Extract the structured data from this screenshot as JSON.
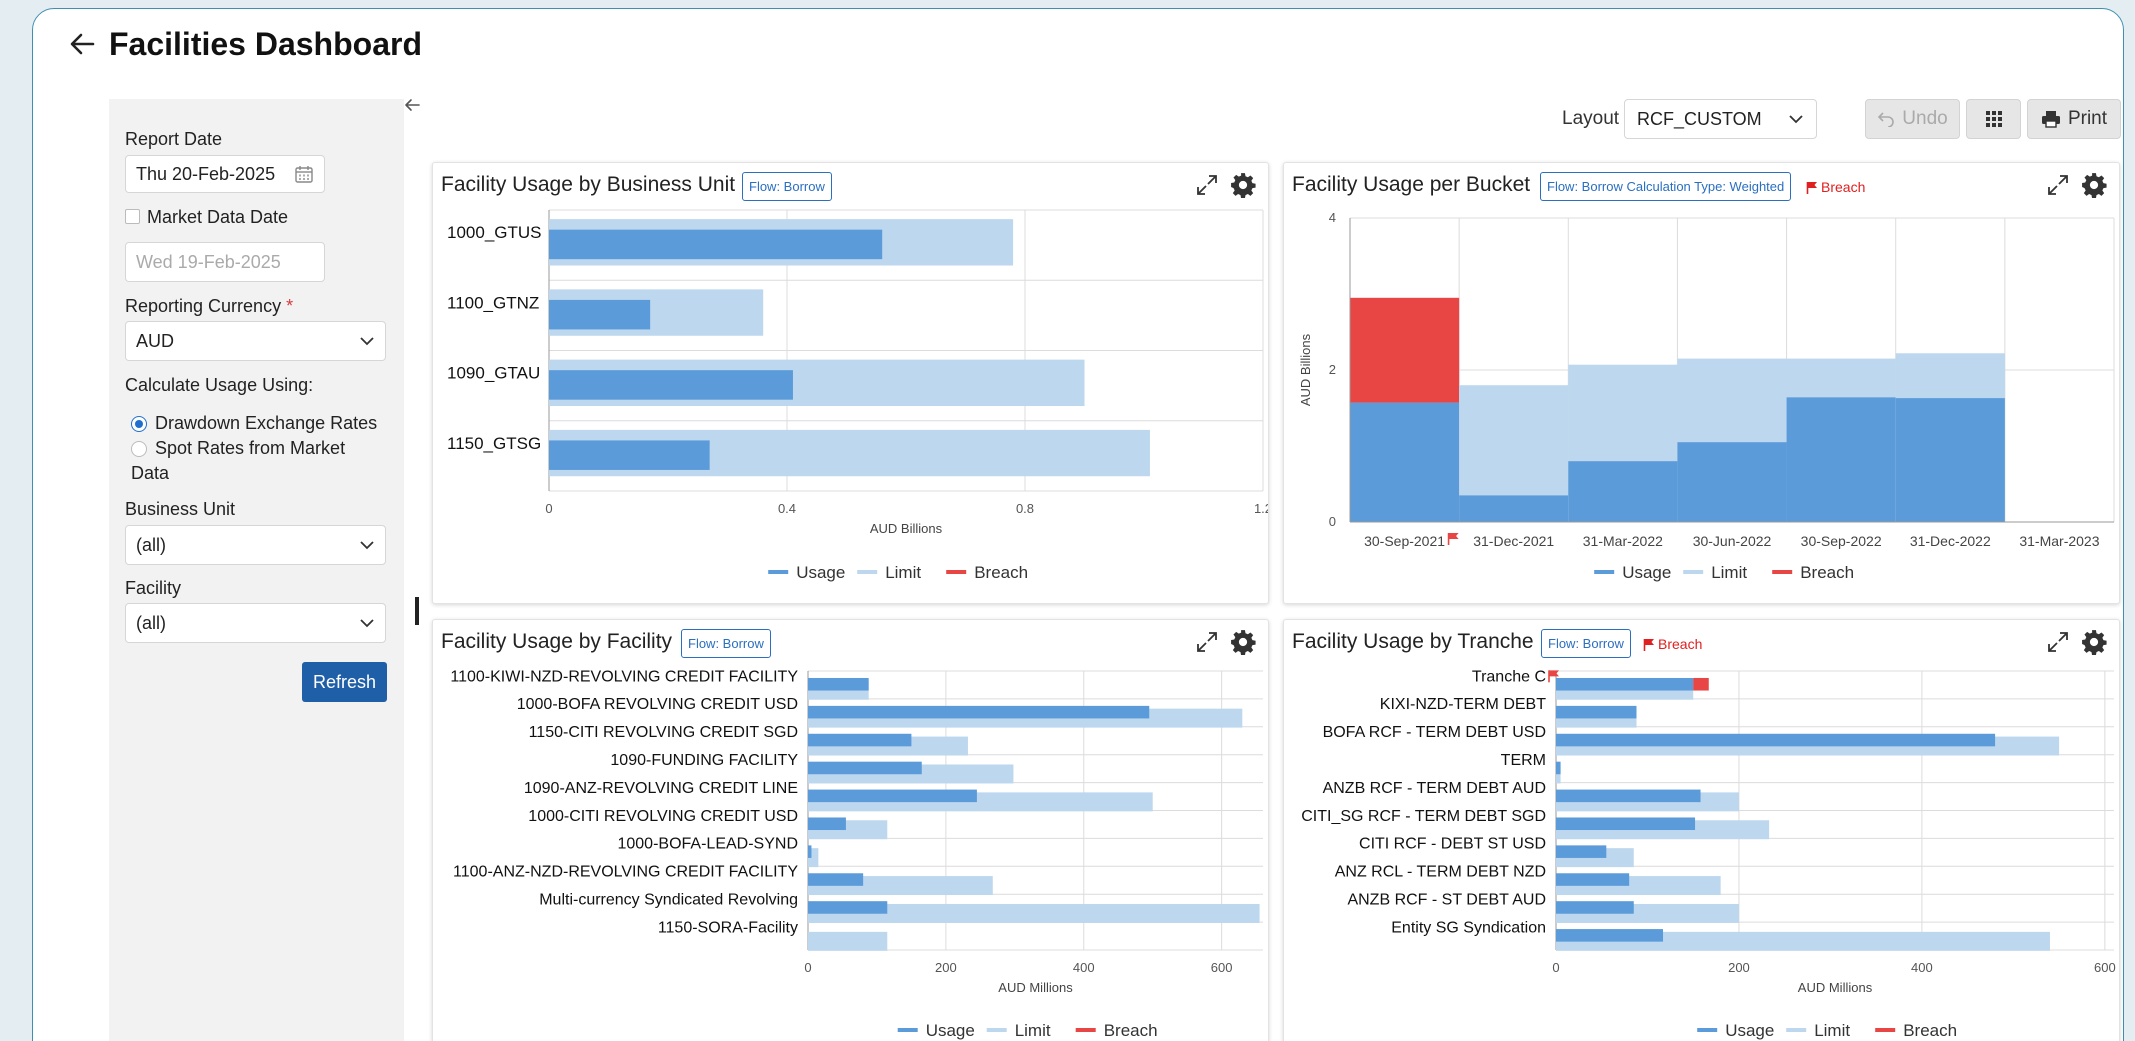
{
  "page": {
    "title": "Facilities Dashboard"
  },
  "sidebar": {
    "report_date_label": "Report Date",
    "report_date_value": "Thu 20-Feb-2025",
    "market_data_date_label": "Market Data Date",
    "market_data_date_placeholder": "Wed 19-Feb-2025",
    "reporting_currency_label": "Reporting Currency",
    "required_mark": "*",
    "reporting_currency_value": "AUD",
    "calc_usage_label": "Calculate Usage Using:",
    "radio_drawdown_label": "Drawdown Exchange Rates",
    "radio_spot_label_line1": "Spot Rates from Market",
    "radio_spot_label_line2": "Data",
    "business_unit_label": "Business Unit",
    "business_unit_value": "(all)",
    "facility_label": "Facility",
    "facility_value": "(all)",
    "refresh_label": "Refresh"
  },
  "toolbar": {
    "layout_label": "Layout",
    "layout_value": "RCF_CUSTOM",
    "undo_label": "Undo",
    "print_label": "Print"
  },
  "legend": {
    "usage": "Usage",
    "limit": "Limit",
    "breach": "Breach"
  },
  "colors": {
    "usage": "#5b9bd9",
    "limit": "#bdd7ee",
    "breach": "#e84545",
    "accent": "#1f5fa8"
  },
  "panels": {
    "bu": {
      "title": "Facility Usage by Business Unit",
      "tag": "Flow: Borrow"
    },
    "bucket": {
      "title": "Facility Usage per Bucket",
      "tag": "Flow: Borrow Calculation Type: Weighted",
      "breach_label": "Breach"
    },
    "facility": {
      "title": "Facility Usage by Facility",
      "tag": "Flow: Borrow"
    },
    "tranche": {
      "title": "Facility Usage by Tranche",
      "tag": "Flow: Borrow",
      "breach_label": "Breach"
    }
  },
  "chart_data": [
    {
      "id": "bu",
      "type": "bar",
      "orientation": "horizontal",
      "categories": [
        "1000_GTUS",
        "1100_GTNZ",
        "1090_GTAU",
        "1150_GTSG"
      ],
      "series": [
        {
          "name": "Usage",
          "values": [
            0.56,
            0.17,
            0.41,
            0.27
          ]
        },
        {
          "name": "Limit",
          "values": [
            0.78,
            0.36,
            0.9,
            1.01
          ]
        }
      ],
      "xlabel": "AUD Billions",
      "xlim": [
        0,
        1.2
      ],
      "ticks": [
        "0",
        "0.4",
        "0.8",
        "1.2"
      ],
      "grid": true,
      "legend": "bottom"
    },
    {
      "id": "bucket",
      "type": "area",
      "x": [
        "30-Sep-2021",
        "31-Dec-2021",
        "31-Mar-2022",
        "30-Jun-2022",
        "30-Sep-2022",
        "31-Dec-2022",
        "31-Mar-2023"
      ],
      "series": [
        {
          "name": "Usage",
          "values": [
            1.57,
            0.35,
            0.8,
            1.05,
            1.64,
            1.63,
            0
          ]
        },
        {
          "name": "Limit",
          "values": [
            1.57,
            1.8,
            2.07,
            2.15,
            2.15,
            2.22,
            0
          ]
        },
        {
          "name": "Breach",
          "values": [
            2.95,
            0,
            0,
            0,
            0,
            0,
            0
          ]
        }
      ],
      "ylabel": "AUD Billions",
      "ylim": [
        0,
        4
      ],
      "yticks": [
        "0",
        "2",
        "4"
      ],
      "breach_flag_category": "30-Sep-2021",
      "grid": true,
      "legend": "bottom"
    },
    {
      "id": "facility",
      "type": "bar",
      "orientation": "horizontal",
      "categories": [
        "1100-KIWI-NZD-REVOLVING CREDIT FACILITY",
        "1000-BOFA REVOLVING CREDIT USD",
        "1150-CITI REVOLVING CREDIT SGD",
        "1090-FUNDING FACILITY",
        "1090-ANZ-REVOLVING CREDIT LINE",
        "1000-CITI REVOLVING CREDIT USD",
        "1000-BOFA-LEAD-SYND",
        "1100-ANZ-NZD-REVOLVING CREDIT FACILITY",
        "Multi-currency Syndicated Revolving",
        "1150-SORA-Facility"
      ],
      "series": [
        {
          "name": "Usage",
          "values": [
            88,
            495,
            150,
            165,
            245,
            55,
            5,
            80,
            115,
            0
          ]
        },
        {
          "name": "Limit",
          "values": [
            88,
            630,
            232,
            298,
            500,
            115,
            15,
            268,
            655,
            115
          ]
        }
      ],
      "xlabel": "AUD Millions",
      "xlim": [
        0,
        660
      ],
      "ticks": [
        "0",
        "200",
        "400",
        "600"
      ],
      "grid": true,
      "legend": "bottom"
    },
    {
      "id": "tranche",
      "type": "bar",
      "orientation": "horizontal",
      "categories": [
        "Tranche C",
        "KIXI-NZD-TERM DEBT",
        "BOFA RCF - TERM DEBT USD",
        "TERM",
        "ANZB RCF - TERM DEBT AUD",
        "CITI_SG RCF - TERM DEBT SGD",
        "CITI RCF - DEBT ST USD",
        "ANZ RCL - TERM DEBT NZD",
        "ANZB RCF - ST DEBT AUD",
        "Entity SG Syndication"
      ],
      "series": [
        {
          "name": "Usage",
          "values": [
            150,
            88,
            480,
            5,
            158,
            152,
            55,
            80,
            85,
            117
          ]
        },
        {
          "name": "Limit",
          "values": [
            150,
            88,
            550,
            5,
            200,
            233,
            85,
            180,
            200,
            540
          ]
        },
        {
          "name": "Breach",
          "values": [
            17,
            0,
            0,
            0,
            0,
            0,
            0,
            0,
            0,
            0
          ]
        }
      ],
      "breach_flag_category": "Tranche C",
      "xlabel": "AUD Millions",
      "xlim": [
        0,
        610
      ],
      "ticks": [
        "0",
        "200",
        "400",
        "600"
      ],
      "grid": true,
      "legend": "bottom"
    }
  ]
}
